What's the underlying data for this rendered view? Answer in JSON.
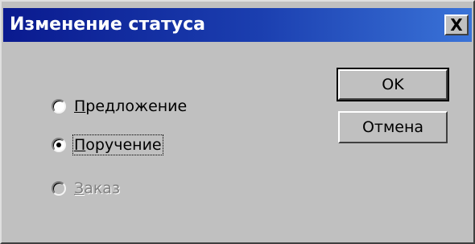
{
  "window": {
    "title": "Изменение статуса",
    "close_label": "X"
  },
  "options": [
    {
      "pre": "",
      "mnemonic": "П",
      "post": "редложение",
      "checked": false,
      "enabled": true,
      "focused": false
    },
    {
      "pre": "",
      "mnemonic": "П",
      "post": "оручение",
      "checked": true,
      "enabled": true,
      "focused": true
    },
    {
      "pre": "",
      "mnemonic": "З",
      "post": "аказ",
      "checked": false,
      "enabled": false,
      "focused": false
    }
  ],
  "buttons": {
    "ok_label": "OK",
    "cancel_label": "Отмена"
  },
  "colors": {
    "face": "#c0c0c0",
    "titlebar_start": "#0a1a8f",
    "titlebar_end": "#3a73d8",
    "disabled_text": "#808080"
  },
  "icons": {
    "close": "close-icon",
    "radio": "radio-icon"
  }
}
